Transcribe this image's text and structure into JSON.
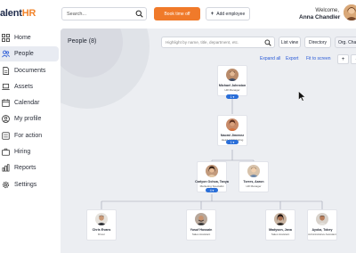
{
  "app": {
    "logo_prefix": "alent",
    "logo_suffix": "HR"
  },
  "sidebar": {
    "items": [
      {
        "label": "Home",
        "icon": "grid-icon",
        "active": false
      },
      {
        "label": "People",
        "icon": "people-icon",
        "active": true
      },
      {
        "label": "Documents",
        "icon": "document-icon",
        "active": false
      },
      {
        "label": "Assets",
        "icon": "laptop-icon",
        "active": false
      },
      {
        "label": "Calendar",
        "icon": "calendar-icon",
        "active": false
      },
      {
        "label": "My profile",
        "icon": "user-icon",
        "active": false
      },
      {
        "label": "For action",
        "icon": "action-icon",
        "active": false
      },
      {
        "label": "Hiring",
        "icon": "briefcase-icon",
        "active": false
      },
      {
        "label": "Reports",
        "icon": "chart-icon",
        "active": false
      },
      {
        "label": "Settings",
        "icon": "gear-icon",
        "active": false
      }
    ]
  },
  "topbar": {
    "search_placeholder": "Search...",
    "book_time_off": "Book time off",
    "add_employee": "Add employee",
    "welcome": "Welcome,",
    "user_name": "Anna Chandler"
  },
  "main": {
    "title": "People (8)",
    "highlight_placeholder": "Highlight by name, title, department, etc.",
    "list_view": "List view",
    "directory": "Directory",
    "org_chart": "Org. Chart",
    "expand_all": "Expand all",
    "export": "Export",
    "fit_to_screen": "Fit to screen",
    "zoom_in": "+",
    "zoom_out": "-"
  },
  "org": {
    "root": {
      "name": "Michael Johnston",
      "role": "HR Manager",
      "badge": "1 ▾"
    },
    "level1": {
      "name": "Naomi Jimenez",
      "role": "Head of Marketing",
      "badge": "1 ▾"
    },
    "level2": [
      {
        "name": "Carlyon Ochoa, Tanya",
        "role": "Marketing Specialist",
        "badge": "4 ▾"
      },
      {
        "name": "Torres, Aaron",
        "role": "HR Manager"
      }
    ],
    "level3": [
      {
        "name": "Chris Evans",
        "role": "Driver"
      },
      {
        "name": "Yusuf Hussain",
        "role": "Sales Assistant"
      },
      {
        "name": "Madyson, Jana",
        "role": "Sales Assistant"
      },
      {
        "name": "Ayoka, Tobey",
        "role": "Administrative Assistant"
      }
    ]
  },
  "colors": {
    "accent": "#f07a2a",
    "link": "#2a5bd7",
    "badge": "#2a6ed8",
    "panel": "#eceef2"
  }
}
